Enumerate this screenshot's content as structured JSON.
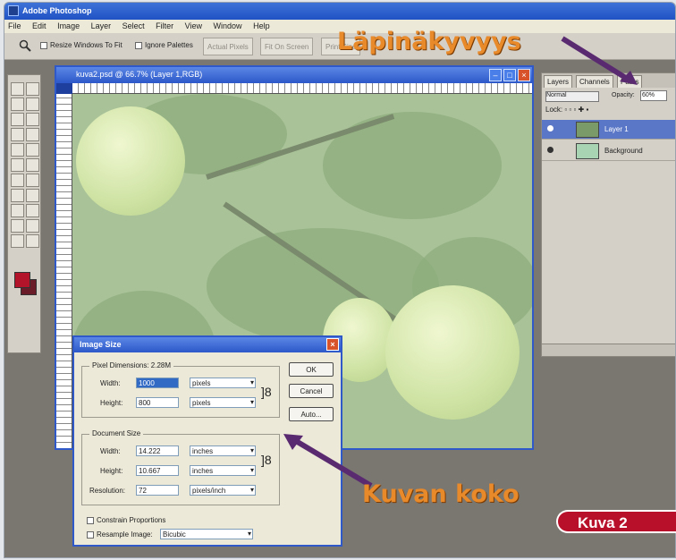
{
  "app_title": "Adobe Photoshop",
  "menu": [
    "File",
    "Edit",
    "Image",
    "Layer",
    "Select",
    "Filter",
    "View",
    "Window",
    "Help"
  ],
  "options_bar": {
    "resize_windows": "Resize Windows To Fit",
    "ignore_palettes": "Ignore Palettes",
    "actual_pixels": "Actual Pixels",
    "fit_on_screen": "Fit On Screen",
    "print_size": "Print Size"
  },
  "document": {
    "title": "kuva2.psd @ 66.7% (Layer 1,RGB)"
  },
  "layers_panel": {
    "tabs": [
      "Layers",
      "Channels",
      "Paths"
    ],
    "mode": "Normal",
    "opacity_label": "Opacity:",
    "opacity_value": "60%",
    "lock_label": "Lock:",
    "layers": [
      {
        "name": "Layer 1",
        "selected": true
      },
      {
        "name": "Background",
        "selected": false
      }
    ]
  },
  "dialog": {
    "title": "Image Size",
    "pixel_dimensions": "Pixel Dimensions: 2.28M",
    "width_label": "Width:",
    "width_value": "1000",
    "width_unit": "pixels",
    "height_label": "Height:",
    "height_value": "800",
    "height_unit": "pixels",
    "document_size": "Document Size",
    "doc_width_value": "14.222",
    "doc_width_unit": "inches",
    "doc_height_value": "10.667",
    "doc_height_unit": "inches",
    "resolution_label": "Resolution:",
    "resolution_value": "72",
    "resolution_unit": "pixels/inch",
    "constrain": "Constrain Proportions",
    "resample": "Resample Image:",
    "resample_value": "Bicubic",
    "ok": "OK",
    "cancel": "Cancel",
    "auto": "Auto..."
  },
  "labels": {
    "lapinakyvyys": "Läpinäkyvyys",
    "kuvan_koko": "Kuvan koko",
    "kuva": "Kuva 2"
  },
  "colors": {
    "foreground": "#b3142a",
    "background": "#6a1d29",
    "label_orange": "#e8892a",
    "badge_red": "#b8102a"
  }
}
